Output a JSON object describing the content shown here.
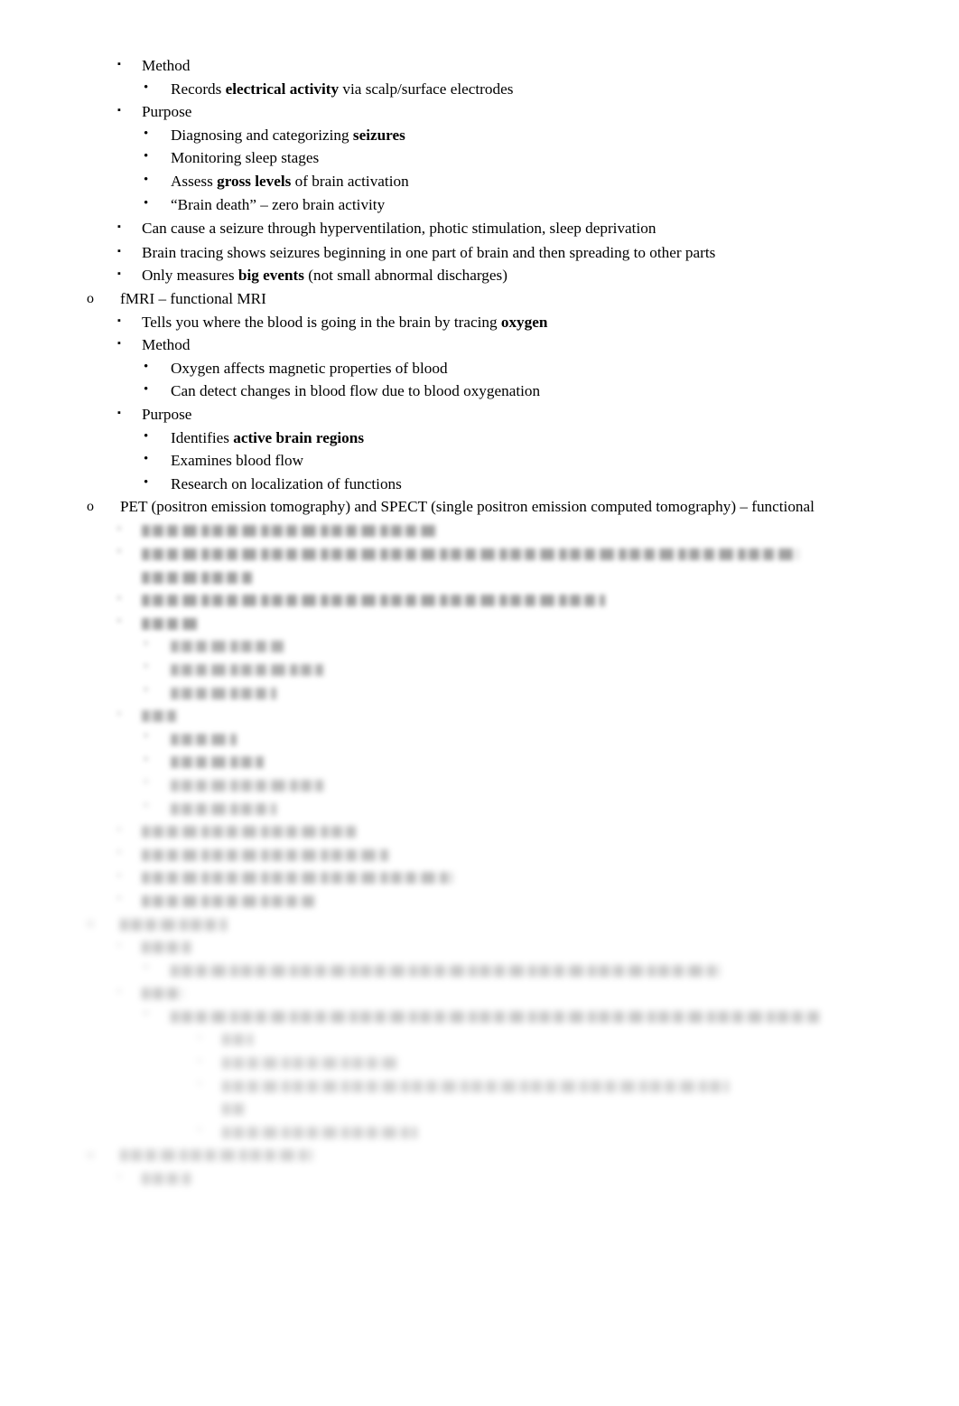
{
  "document": {
    "page_background": "#ffffff",
    "text_color": "#000000",
    "markers": {
      "level1": "o",
      "level2": "▪",
      "level3": "•",
      "level4": "▪",
      "level5": "•"
    }
  },
  "outline": {
    "eeg_section": [
      {
        "level": 2,
        "marker": "▪",
        "text": "Method",
        "legible": true
      },
      {
        "level": 3,
        "marker": "•",
        "text": "Records electrical activity via scalp/surface electrodes",
        "bold_runs": [
          "electrical activity"
        ],
        "legible": true
      },
      {
        "level": 2,
        "marker": "▪",
        "text": "Purpose",
        "legible": true
      },
      {
        "level": 3,
        "marker": "•",
        "text": "Diagnosing and categorizing seizures",
        "bold_runs": [
          "seizures"
        ],
        "legible": true
      },
      {
        "level": 3,
        "marker": "•",
        "text": "Monitoring sleep stages",
        "legible": true
      },
      {
        "level": 3,
        "marker": "•",
        "text": "Assess gross levels of brain activation",
        "bold_runs": [
          "gross levels"
        ],
        "legible": true
      },
      {
        "level": 3,
        "marker": "•",
        "text": "“Brain death” – zero brain activity",
        "legible": true
      },
      {
        "level": 2,
        "marker": "▪",
        "text": "Can cause a seizure through hyperventilation, photic stimulation, sleep deprivation",
        "legible": true
      },
      {
        "level": 2,
        "marker": "▪",
        "text": "Brain tracing shows seizures beginning in one part of brain and then spreading to other parts",
        "legible": true
      },
      {
        "level": 2,
        "marker": "▪",
        "text": "Only measures big events (not small abnormal discharges)",
        "bold_runs": [
          "big events"
        ],
        "legible": true
      }
    ],
    "fmri_section": [
      {
        "level": 1,
        "marker": "o",
        "text": "fMRI – functional MRI",
        "legible": true
      },
      {
        "level": 2,
        "marker": "▪",
        "text": "Tells you where the blood is going in the brain by tracing oxygen",
        "bold_runs": [
          "oxygen"
        ],
        "legible": true
      },
      {
        "level": 2,
        "marker": "▪",
        "text": "Method",
        "legible": true
      },
      {
        "level": 3,
        "marker": "•",
        "text": "Oxygen affects magnetic properties of blood",
        "legible": true
      },
      {
        "level": 3,
        "marker": "•",
        "text": "Can detect changes in blood flow due to blood oxygenation",
        "legible": true
      },
      {
        "level": 2,
        "marker": "▪",
        "text": "Purpose",
        "legible": true
      },
      {
        "level": 3,
        "marker": "•",
        "text": "Identifies active brain regions",
        "bold_runs": [
          "active brain regions"
        ],
        "legible": true
      },
      {
        "level": 3,
        "marker": "•",
        "text": "Examines blood flow",
        "legible": true
      },
      {
        "level": 3,
        "marker": "•",
        "text": "Research on localization of functions",
        "legible": true
      }
    ],
    "pet_section": [
      {
        "level": 1,
        "marker": "o",
        "text": "PET (positron emission tomography) and SPECT (single positron emission computed tomography) – functional",
        "legible": true
      }
    ],
    "faded_region": {
      "note_visible_state": "blurred and faded – glyphs are not legible in the screenshot",
      "lines": [
        {
          "level": 2,
          "marker": "▪",
          "fade": "a",
          "crisp_marker": true,
          "width_pct": 43
        },
        {
          "level": 2,
          "marker": "▪",
          "fade": "a",
          "width_pct": 95
        },
        {
          "level": 2,
          "marker": "",
          "fade": "a",
          "width_pct": 16,
          "continuation": true
        },
        {
          "level": 2,
          "marker": "▪",
          "fade": "a",
          "width_pct": 67
        },
        {
          "level": 2,
          "marker": "▪",
          "fade": "a",
          "width_pct": 8
        },
        {
          "level": 3,
          "marker": "•",
          "fade": "b",
          "width_pct": 17
        },
        {
          "level": 3,
          "marker": "•",
          "fade": "b",
          "width_pct": 23
        },
        {
          "level": 3,
          "marker": "•",
          "fade": "b",
          "width_pct": 16
        },
        {
          "level": 2,
          "marker": "▪",
          "fade": "b",
          "width_pct": 5
        },
        {
          "level": 3,
          "marker": "•",
          "fade": "b",
          "width_pct": 10
        },
        {
          "level": 3,
          "marker": "•",
          "fade": "b",
          "width_pct": 14
        },
        {
          "level": 3,
          "marker": "•",
          "fade": "c",
          "width_pct": 23
        },
        {
          "level": 3,
          "marker": "•",
          "fade": "c",
          "width_pct": 16
        },
        {
          "level": 2,
          "marker": "▪",
          "fade": "c",
          "width_pct": 31
        },
        {
          "level": 2,
          "marker": "▪",
          "fade": "c",
          "width_pct": 36
        },
        {
          "level": 2,
          "marker": "▪",
          "fade": "c",
          "width_pct": 45
        },
        {
          "level": 2,
          "marker": "▪",
          "fade": "c",
          "width_pct": 25
        },
        {
          "level": 1,
          "marker": "o",
          "fade": "d",
          "width_pct": 15
        },
        {
          "level": 2,
          "marker": "▪",
          "fade": "d",
          "width_pct": 7
        },
        {
          "level": 3,
          "marker": "•",
          "fade": "d",
          "width_pct": 83
        },
        {
          "level": 2,
          "marker": "▪",
          "fade": "d",
          "width_pct": 6
        },
        {
          "level": 3,
          "marker": "•",
          "fade": "d",
          "width_pct": 98
        },
        {
          "level": 4,
          "marker": "▪",
          "fade": "e",
          "width_pct": 5,
          "continuation": true
        },
        {
          "level": 4,
          "marker": "▪",
          "fade": "e",
          "width_pct": 29
        },
        {
          "level": 4,
          "marker": "▪",
          "fade": "e",
          "width_pct": 83
        },
        {
          "level": 4,
          "marker": "",
          "fade": "e",
          "width_pct": 4,
          "continuation": true
        },
        {
          "level": 4,
          "marker": "▪",
          "fade": "e",
          "width_pct": 32
        },
        {
          "level": 1,
          "marker": "o",
          "fade": "e",
          "width_pct": 27
        },
        {
          "level": 2,
          "marker": "▪",
          "fade": "e",
          "width_pct": 7
        }
      ]
    }
  }
}
